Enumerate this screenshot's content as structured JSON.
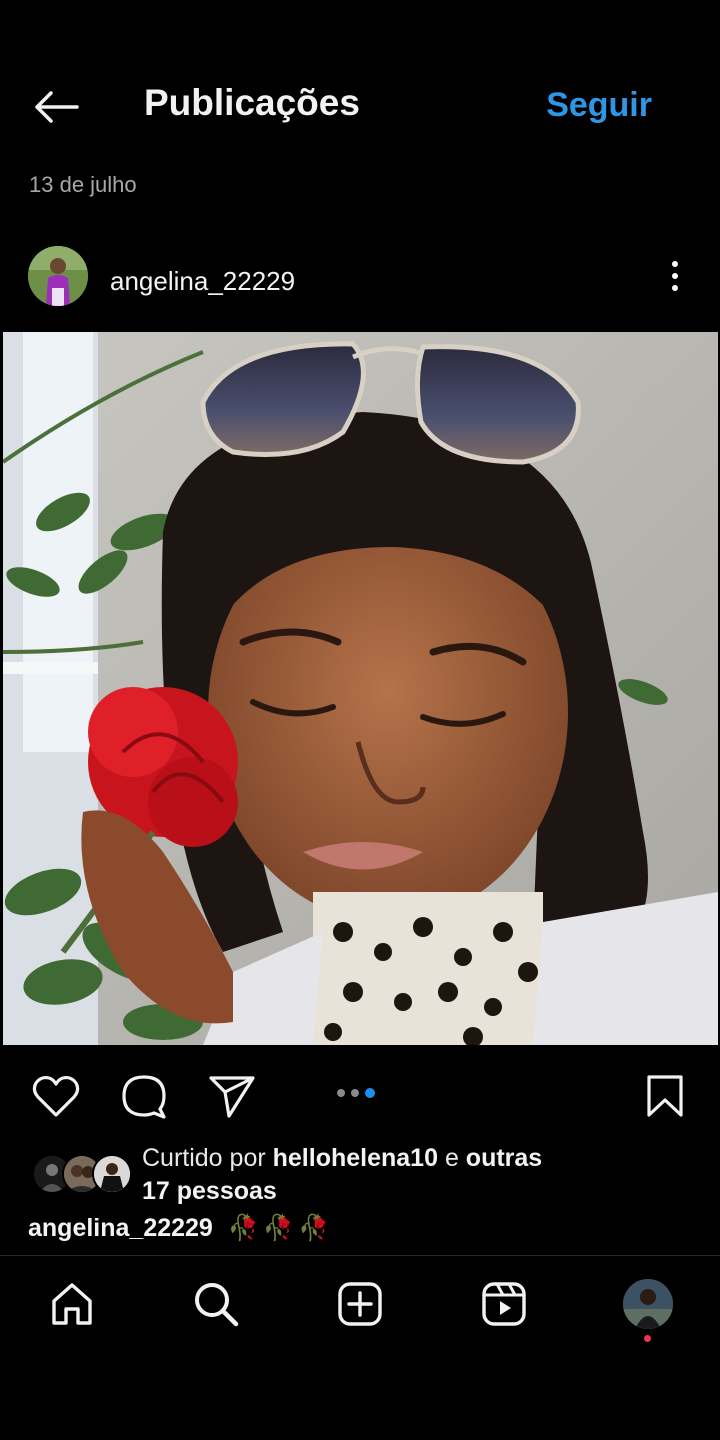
{
  "header": {
    "title": "Publicações",
    "follow_label": "Seguir"
  },
  "post": {
    "date": "13 de julho",
    "username": "angelina_22229",
    "carousel": {
      "total": 3,
      "active_index": 3
    },
    "likes": {
      "prefix": "Curtido por",
      "user": "hellohelena10",
      "connector": "e",
      "others_line1": "outras",
      "others_line2": "17 pessoas"
    },
    "caption": {
      "user": "angelina_22229",
      "emojis": "🥀🥀🥀"
    }
  },
  "icons": {
    "back": "arrow-left-icon",
    "more": "more-vertical-icon",
    "like": "heart-icon",
    "comment": "comment-icon",
    "share": "send-icon",
    "save": "bookmark-icon",
    "home": "home-icon",
    "search": "search-icon",
    "create": "plus-square-icon",
    "reels": "reels-icon"
  },
  "colors": {
    "background": "#000000",
    "accent": "#2f96e6",
    "notification": "#f0364d"
  }
}
